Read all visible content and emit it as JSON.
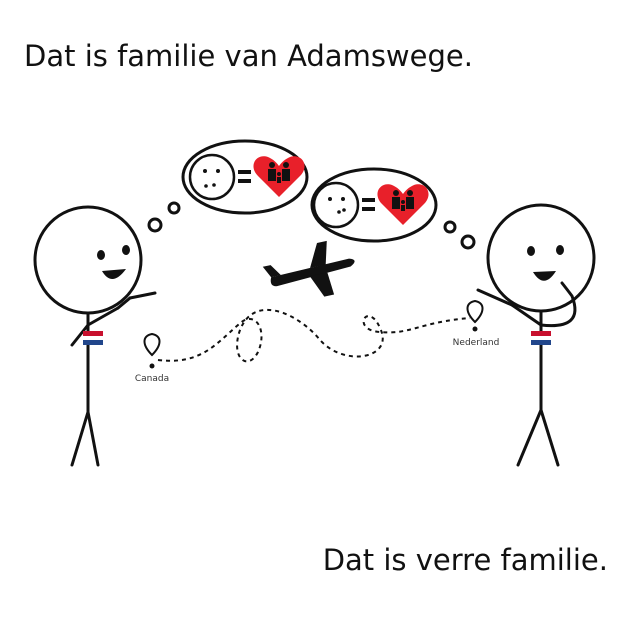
{
  "captions": {
    "top": "Dat is familie van Adamswege.",
    "bottom": "Dat is verre familie."
  },
  "places": {
    "left": "Canada",
    "right": "Nederland"
  },
  "colors": {
    "ink": "#111111",
    "heart": "#e8202a",
    "flag_red": "#c8102e",
    "flag_white": "#ffffff",
    "flag_blue": "#21468b"
  },
  "icons": [
    "airplane-icon",
    "heart-family-icon",
    "location-pin-icon",
    "smiley-face-icon",
    "dutch-flag-icon"
  ]
}
